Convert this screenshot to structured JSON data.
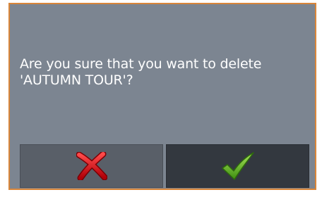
{
  "dialog": {
    "message_line1": "Are you sure that you want to delete",
    "message_line2": "'AUTUMN TOUR'?"
  },
  "buttons": {
    "cancel_icon": "red-x-icon",
    "confirm_icon": "green-checkmark-icon"
  },
  "colors": {
    "dialog_bg": "#7c8591",
    "border_accent": "#d9863a",
    "cancel_bg": "#595f68",
    "confirm_bg": "#33383f",
    "cancel_icon": "#e0141a",
    "confirm_icon": "#5fb22a"
  }
}
